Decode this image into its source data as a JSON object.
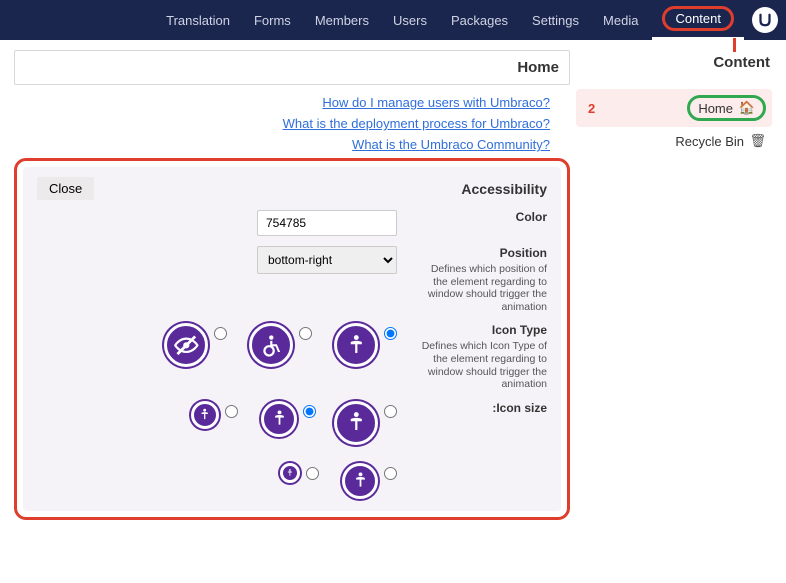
{
  "nav": {
    "items": [
      "Content",
      "Media",
      "Settings",
      "Packages",
      "Users",
      "Members",
      "Forms",
      "Translation"
    ],
    "activeIndex": 0
  },
  "sidebar": {
    "title": "Content",
    "home": "Home",
    "recycle": "Recycle Bin",
    "badge": "2"
  },
  "page": {
    "title": "Home",
    "links": [
      "How do I manage users with Umbraco?",
      "What is the deployment process for Umbraco?",
      "What is the Umbraco Community?"
    ]
  },
  "panel": {
    "title": "Accessibility",
    "close": "Close",
    "color_label": "Color",
    "color_value": "754785",
    "position_label": "Position",
    "position_desc": "Defines which position of the element regarding to window should trigger the animation",
    "position_value": "bottom-right",
    "icontype_label": "Icon Type",
    "icontype_desc": "Defines which Icon Type of the element regarding to window should trigger the animation",
    "iconsize_label": "Icon size:"
  }
}
